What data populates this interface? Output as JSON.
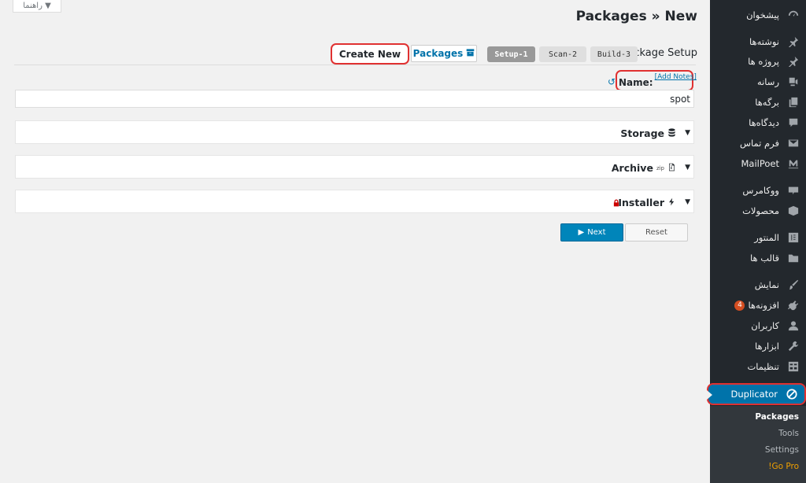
{
  "help_tab": {
    "label": "راهنما ▼"
  },
  "page": {
    "title": "Packages » New",
    "subtitle": "Step 1: Package Setup",
    "subtitle_visible": "ackage Setup"
  },
  "toolbar": {
    "create_new_label": "Create New",
    "packages_label": "Packages"
  },
  "steps": [
    {
      "label": "Setup-1",
      "active": true
    },
    {
      "label": "Scan-2",
      "active": false
    },
    {
      "label": "Build-3",
      "active": false
    }
  ],
  "name_field": {
    "label": "Name:",
    "add_notes": "[Add Notes]",
    "value": "spot"
  },
  "panels": [
    {
      "title": "Storage",
      "icon": "database-icon"
    },
    {
      "title": "Archive",
      "icon": "file-archive-icon",
      "sup": "zip"
    },
    {
      "title": "Installer",
      "icon": "bolt-icon",
      "locked": true
    }
  ],
  "actions": {
    "next_label": "Next",
    "reset_label": "Reset"
  },
  "sidebar": {
    "items": [
      {
        "label": "پیشخوان",
        "icon": "dashboard-icon"
      },
      {
        "label": "نوشته‌ها",
        "icon": "pin-icon"
      },
      {
        "label": "پروژه ها",
        "icon": "pin-icon"
      },
      {
        "label": "رسانه",
        "icon": "media-icon"
      },
      {
        "label": "برگه‌ها",
        "icon": "pages-icon"
      },
      {
        "label": "دیدگاه‌ها",
        "icon": "comments-icon"
      },
      {
        "label": "فرم تماس",
        "icon": "mail-icon"
      },
      {
        "label": "MailPoet",
        "icon": "mailpoet-icon"
      },
      {
        "label": "ووکامرس",
        "icon": "woocommerce-icon"
      },
      {
        "label": "محصولات",
        "icon": "products-icon"
      },
      {
        "label": "المنتور",
        "icon": "elementor-icon"
      },
      {
        "label": "قالب ها",
        "icon": "folder-icon"
      },
      {
        "label": "نمایش",
        "icon": "appearance-icon"
      },
      {
        "label": "افزونه‌ها",
        "icon": "plugins-icon",
        "badge": "4"
      },
      {
        "label": "کاربران",
        "icon": "users-icon"
      },
      {
        "label": "ابزارها",
        "icon": "tools-icon"
      },
      {
        "label": "تنظیمات",
        "icon": "settings-icon"
      },
      {
        "label": "Duplicator",
        "icon": "duplicator-icon",
        "active": true
      }
    ],
    "submenu": [
      {
        "label": "Packages",
        "current": true
      },
      {
        "label": "Tools"
      },
      {
        "label": "Settings"
      },
      {
        "label": "!Go Pro",
        "gopro": true
      }
    ]
  }
}
